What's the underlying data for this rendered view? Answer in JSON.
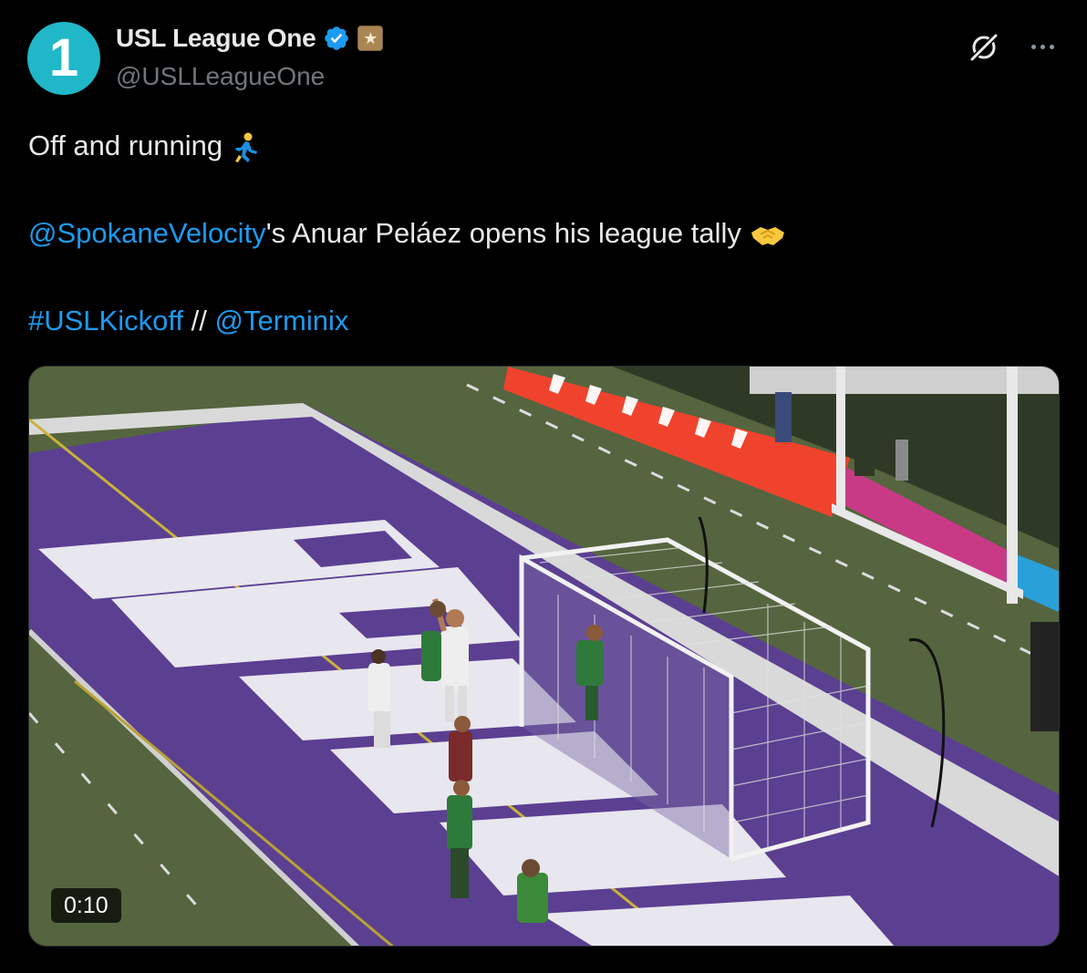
{
  "author": {
    "avatar_text": "1",
    "display_name": "USL League One",
    "handle": "@USLLeagueOne",
    "verified_icon": "verified-badge-icon",
    "affiliate_icon": "affiliate-badge-icon"
  },
  "actions": {
    "grok_icon": "grok-icon",
    "more_icon": "more-options-icon"
  },
  "text": {
    "line1": "Off and running",
    "line1_emoji": "person-running-emoji",
    "line2_mention": "@SpokaneVelocity",
    "line2_rest": "'s Anuar Peláez opens his league tally",
    "line2_emoji": "handshake-emoji",
    "line3_hashtag": "#USLKickoff",
    "line3_sep": " // ",
    "line3_mention": "@Terminix"
  },
  "media": {
    "type": "video",
    "duration": "0:10"
  },
  "colors": {
    "link": "#1d9bf0",
    "avatar_bg": "#20b7c9",
    "field_purple": "#5b3f91",
    "text_primary": "#e7e9ea",
    "text_secondary": "#71767b"
  }
}
